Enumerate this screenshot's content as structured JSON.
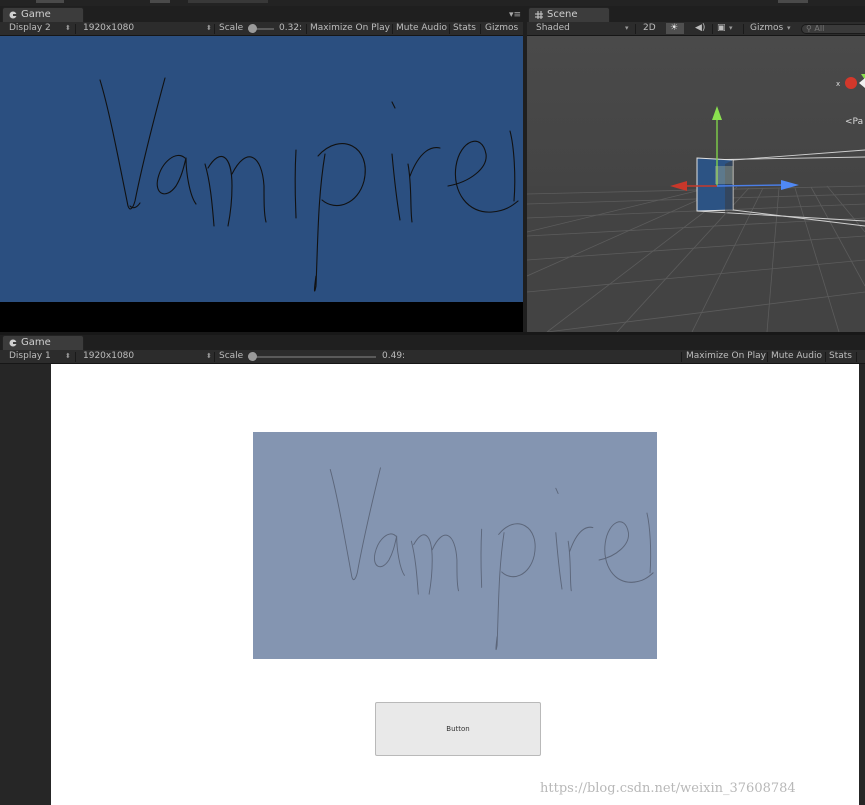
{
  "top_game": {
    "tab_label": "Game",
    "display": "Display 2",
    "resolution": "1920x1080",
    "scale_label": "Scale",
    "scale_value": "0.32:",
    "maximize_label": "Maximize On Play",
    "mute_label": "Mute Audio",
    "stats_label": "Stats",
    "gizmos_label": "Gizmos",
    "background_color": "#2b4f80",
    "handwriting": "Vampire"
  },
  "scene": {
    "tab_label": "Scene",
    "shading_mode": "Shaded",
    "mode_2d": "2D",
    "gizmos_label": "Gizmos",
    "search_placeholder": "All",
    "persp_label": "Pa"
  },
  "bottom_game": {
    "tab_label": "Game",
    "display": "Display 1",
    "resolution": "1920x1080",
    "scale_label": "Scale",
    "scale_value": "0.49:",
    "maximize_label": "Maximize On Play",
    "mute_label": "Mute Audio",
    "stats_label": "Stats",
    "panel_color": "#8495b1",
    "button_label": "Button",
    "handwriting": "Vampire"
  },
  "watermark": "https://blog.csdn.net/weixin_37608784"
}
